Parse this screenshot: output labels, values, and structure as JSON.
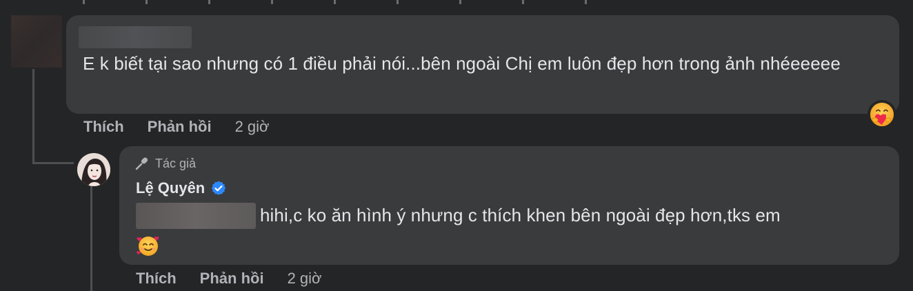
{
  "comment_1": {
    "text": "E k biết tại sao nhưng có 1 điều phải nói...bên ngoài Chị em luôn đẹp hơn trong ảnh nhéeeeee",
    "actions": {
      "like": "Thích",
      "reply": "Phản hồi",
      "time": "2 giờ"
    },
    "reaction_icon": "care-reaction-icon"
  },
  "reply_1": {
    "author_badge": "Tác giả",
    "author_name": "Lệ Quyên",
    "text": "hihi,c ko ăn hình ý nhưng c thích khen bên ngoài đẹp hơn,tks em",
    "emoji": "smiling-face-with-hearts",
    "actions": {
      "like": "Thích",
      "reply": "Phản hồi",
      "time": "2 giờ"
    }
  },
  "colors": {
    "background": "#242526",
    "bubble": "#3a3b3c",
    "text": "#e4e6eb",
    "secondary_text": "#b0b3b8",
    "verified": "#2d88ff",
    "thread_line": "#4e4f50"
  }
}
